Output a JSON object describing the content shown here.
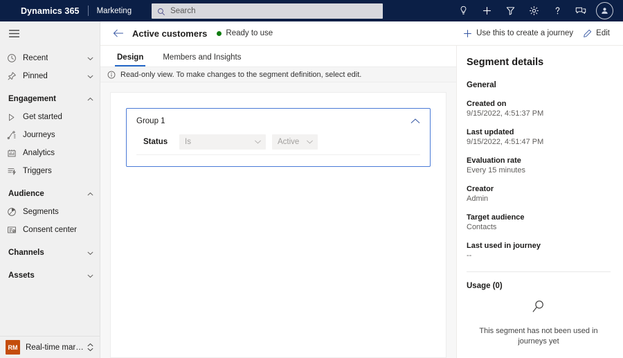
{
  "topbar": {
    "brand": "Dynamics 365",
    "app": "Marketing",
    "search": {
      "placeholder": "Search",
      "value": "",
      "icon": "search-icon"
    },
    "icons": [
      {
        "name": "lightbulb-icon",
        "title": "Insights"
      },
      {
        "name": "plus-icon",
        "title": "New"
      },
      {
        "name": "filter-icon",
        "title": "Filter"
      },
      {
        "name": "gear-icon",
        "title": "Settings"
      },
      {
        "name": "question-icon",
        "title": "Help"
      },
      {
        "name": "feedback-icon",
        "title": "Feedback"
      }
    ],
    "avatar": {
      "name": "avatar",
      "title": "Account manager"
    },
    "background": "#0b1f46"
  },
  "sidebar": {
    "hamburger_label": "Site map",
    "items": [
      {
        "label": "Recent",
        "icon": "clock-icon",
        "type": "item",
        "expandable": true
      },
      {
        "label": "Pinned",
        "icon": "pin-icon",
        "type": "item",
        "expandable": true
      },
      {
        "label": "Engagement",
        "type": "group",
        "expanded": true
      },
      {
        "label": "Get started",
        "icon": "play-icon",
        "type": "item"
      },
      {
        "label": "Journeys",
        "icon": "journeys-icon",
        "type": "item"
      },
      {
        "label": "Analytics",
        "icon": "analytics-icon",
        "type": "item"
      },
      {
        "label": "Triggers",
        "icon": "triggers-icon",
        "type": "item"
      },
      {
        "label": "Audience",
        "type": "group",
        "expanded": true
      },
      {
        "label": "Segments",
        "icon": "segments-icon",
        "type": "item"
      },
      {
        "label": "Consent center",
        "icon": "consent-icon",
        "type": "item"
      },
      {
        "label": "Channels",
        "type": "group",
        "expanded": false
      },
      {
        "label": "Assets",
        "type": "group",
        "expanded": false
      }
    ],
    "area_switcher": {
      "badge": "RM",
      "label": "Real-time marketi...",
      "badge_color": "#c44d0b"
    }
  },
  "command_bar": {
    "back_label": "Back",
    "title": "Active customers",
    "status": {
      "text": "Ready to use",
      "color": "#107c10"
    },
    "actions": [
      {
        "label": "Use this to create a journey",
        "icon": "plus-icon"
      },
      {
        "label": "Edit",
        "icon": "pencil-icon"
      }
    ]
  },
  "tabs": [
    {
      "label": "Design",
      "active": true
    },
    {
      "label": "Members and Insights",
      "active": false
    }
  ],
  "infobar": {
    "icon": "info-icon",
    "text": "Read-only view. To make changes to the segment definition, select edit."
  },
  "designer": {
    "group": {
      "title": "Group 1",
      "collapse_icon": "chevron-up-icon",
      "condition": {
        "attribute": "Status",
        "operator": "Is",
        "value": "Active"
      }
    }
  },
  "details": {
    "title": "Segment details",
    "section": "General",
    "fields": [
      {
        "label": "Created on",
        "value": "9/15/2022, 4:51:37 PM"
      },
      {
        "label": "Last updated",
        "value": "9/15/2022, 4:51:47 PM"
      },
      {
        "label": "Evaluation rate",
        "value": "Every 15 minutes"
      },
      {
        "label": "Creator",
        "value": "Admin"
      },
      {
        "label": "Target audience",
        "value": "Contacts"
      },
      {
        "label": "Last used in journey",
        "value": "--"
      }
    ],
    "usage": {
      "title": "Usage (0)",
      "empty_icon": "magnifier-icon",
      "empty_text": "This segment has not been used in journeys yet"
    }
  }
}
